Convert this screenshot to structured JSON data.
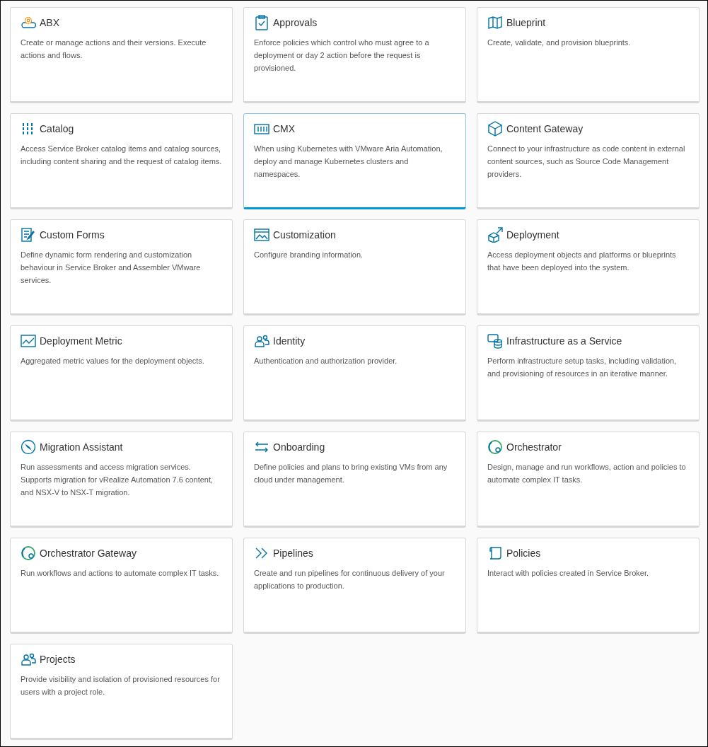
{
  "cards": [
    {
      "title": "ABX",
      "description": "Create or manage actions and their versions. Execute actions and flows.",
      "selected": false
    },
    {
      "title": "Approvals",
      "description": "Enforce policies which control who must agree to a deployment or day 2 action before the request is provisioned.",
      "selected": false
    },
    {
      "title": "Blueprint",
      "description": "Create, validate, and provision blueprints.",
      "selected": false
    },
    {
      "title": "Catalog",
      "description": "Access Service Broker catalog items and catalog sources, including content sharing and the request of catalog items.",
      "selected": false
    },
    {
      "title": "CMX",
      "description": "When using Kubernetes with VMware Aria Automation, deploy and manage Kubernetes clusters and namespaces.",
      "selected": true
    },
    {
      "title": "Content Gateway",
      "description": "Connect to your infrastructure as code content in external content sources, such as Source Code Management providers.",
      "selected": false
    },
    {
      "title": "Custom Forms",
      "description": "Define dynamic form rendering and customization behaviour in Service Broker and Assembler VMware services.",
      "selected": false
    },
    {
      "title": "Customization",
      "description": "Configure branding information.",
      "selected": false
    },
    {
      "title": "Deployment",
      "description": "Access deployment objects and platforms or blueprints that have been deployed into the system.",
      "selected": false
    },
    {
      "title": "Deployment Metric",
      "description": "Aggregated metric values for the deployment objects.",
      "selected": false
    },
    {
      "title": "Identity",
      "description": "Authentication and authorization provider.",
      "selected": false
    },
    {
      "title": "Infrastructure as a Service",
      "description": "Perform infrastructure setup tasks, including validation, and provisioning of resources in an iterative manner.",
      "selected": false
    },
    {
      "title": "Migration Assistant",
      "description": "Run assessments and access migration services. Supports migration for vRealize Automation 7.6 content, and NSX-V to NSX-T migration.",
      "selected": false
    },
    {
      "title": "Onboarding",
      "description": "Define policies and plans to bring existing VMs from any cloud under management.",
      "selected": false
    },
    {
      "title": "Orchestrator",
      "description": "Design, manage and run workflows, action and policies to automate complex IT tasks.",
      "selected": false
    },
    {
      "title": "Orchestrator Gateway",
      "description": "Run workflows and actions to automate complex IT tasks.",
      "selected": false
    },
    {
      "title": "Pipelines",
      "description": "Create and run pipelines for continuous delivery of your applications to production.",
      "selected": false
    },
    {
      "title": "Policies",
      "description": "Interact with policies created in Service Broker.",
      "selected": false
    },
    {
      "title": "Projects",
      "description": "Provide visibility and isolation of provisioned resources for users with a project role.",
      "selected": false
    }
  ]
}
